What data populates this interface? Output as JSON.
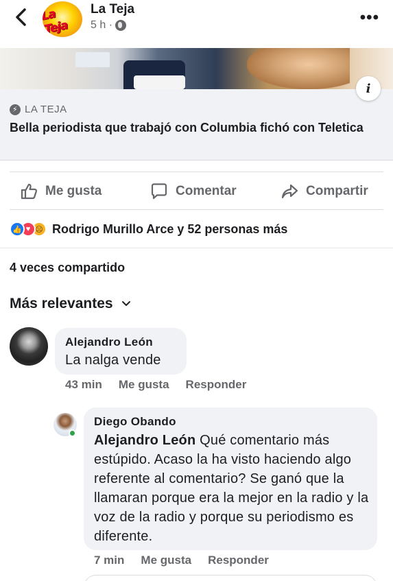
{
  "header": {
    "page_name": "La Teja",
    "time": "5 h ·",
    "logo_text": "La Teja",
    "more_label": "•••"
  },
  "link_preview": {
    "source": "LA TEJA",
    "title": "Bella periodista que trabajó con Columbia fichó con Teletica",
    "info_label": "i"
  },
  "actions": {
    "like": "Me gusta",
    "comment": "Comentar",
    "share": "Compartir"
  },
  "reactions": {
    "summary": "Rodrigo Murillo Arce y 52 personas más",
    "icons": [
      "like-icon",
      "love-icon",
      "sad-icon"
    ]
  },
  "shares": "4 veces compartido",
  "sort_label": "Más relevantes",
  "comments": [
    {
      "author": "Alejandro León",
      "text": "La nalga vende",
      "time": "43 min",
      "like": "Me gusta",
      "reply": "Responder"
    },
    {
      "author": "Diego Obando",
      "mention": "Alejandro León",
      "text": "Qué comentario más estúpido. Acaso la ha visto haciendo algo referente al comentario? Se ganó que la llamaran porque era la mejor en la radio y la voz de la radio y porque su periodismo es diferente.",
      "time": "7 min",
      "like": "Me gusta",
      "reply": "Responder"
    }
  ],
  "colors": {
    "primary_text": "#1c1e21",
    "secondary_text": "#65676b",
    "bubble_bg": "#f0f2f5",
    "like_blue": "#1877f2",
    "love_red": "#f33e58",
    "sad_yellow": "#f7b125",
    "online_green": "#31a24c"
  }
}
